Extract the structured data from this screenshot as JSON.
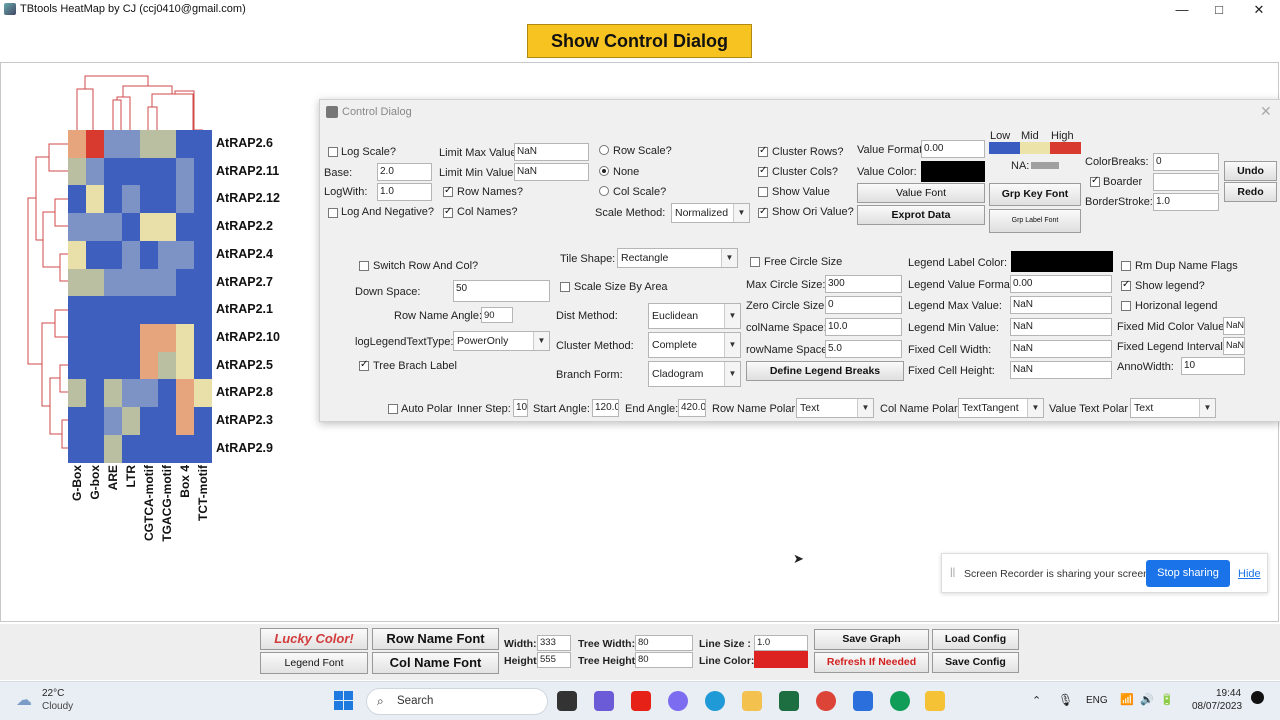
{
  "window": {
    "title": "TBtools HeatMap by CJ (ccj0410@gmail.com)",
    "minimize": "—",
    "maximize": "□",
    "close": "✕"
  },
  "show_control_button": "Show Control Dialog",
  "heatmap": {
    "rows": [
      "AtRAP2.6",
      "AtRAP2.11",
      "AtRAP2.12",
      "AtRAP2.2",
      "AtRAP2.4",
      "AtRAP2.7",
      "AtRAP2.1",
      "AtRAP2.10",
      "AtRAP2.5",
      "AtRAP2.8",
      "AtRAP2.3",
      "AtRAP2.9"
    ],
    "cols": [
      "G-Box",
      "G-box",
      "ARE",
      "LTR",
      "CGTCA-motif",
      "TGACG-motif",
      "Box 4",
      "TCT-motif"
    ],
    "palette": {
      "L": "#3f5fbf",
      "LM": "#7d93c6",
      "M": "#b9bfa0",
      "MH": "#e8e0a8",
      "O": "#e6a57c",
      "H": "#d93a2f"
    },
    "cells": [
      [
        "O",
        "H",
        "LM",
        "LM",
        "M",
        "M",
        "L",
        "L"
      ],
      [
        "M",
        "LM",
        "L",
        "L",
        "L",
        "L",
        "LM",
        "L"
      ],
      [
        "L",
        "MH",
        "L",
        "LM",
        "L",
        "L",
        "LM",
        "L"
      ],
      [
        "LM",
        "LM",
        "LM",
        "L",
        "MH",
        "MH",
        "L",
        "L"
      ],
      [
        "MH",
        "L",
        "L",
        "LM",
        "L",
        "LM",
        "LM",
        "L"
      ],
      [
        "M",
        "M",
        "LM",
        "LM",
        "LM",
        "LM",
        "L",
        "L"
      ],
      [
        "L",
        "L",
        "L",
        "L",
        "L",
        "L",
        "L",
        "L"
      ],
      [
        "L",
        "L",
        "L",
        "L",
        "O",
        "O",
        "MH",
        "L"
      ],
      [
        "L",
        "L",
        "L",
        "L",
        "O",
        "M",
        "MH",
        "L"
      ],
      [
        "M",
        "L",
        "M",
        "LM",
        "LM",
        "L",
        "O",
        "MH"
      ],
      [
        "L",
        "L",
        "LM",
        "M",
        "L",
        "L",
        "O",
        "L"
      ],
      [
        "L",
        "L",
        "M",
        "L",
        "L",
        "L",
        "L",
        "L"
      ],
      [
        "L",
        "L",
        "O",
        "MH",
        "L",
        "L",
        "L",
        "L"
      ]
    ]
  },
  "dialog": {
    "title": "Control Dialog",
    "log_scale": "Log Scale?",
    "base_label": "Base:",
    "base_value": "2.0",
    "logwith_label": "LogWith:",
    "logwith_value": "1.0",
    "log_negative": "Log And Negative?",
    "limit_max_label": "Limit Max Value:",
    "limit_max_value": "NaN",
    "limit_min_label": "Limit Min Value:",
    "limit_min_value": "NaN",
    "row_names": "Row Names?",
    "col_names": "Col Names?",
    "row_scale": "Row Scale?",
    "none": "None",
    "col_scale": "Col Scale?",
    "scale_method_label": "Scale Method:",
    "scale_method_value": "Normalized",
    "cluster_rows": "Cluster Rows?",
    "cluster_cols": "Cluster Cols?",
    "show_value": "Show Value",
    "show_ori_value": "Show Ori Value?",
    "value_format_label": "Value Format:",
    "value_format_value": "0.00",
    "value_color_label": "Value Color:",
    "value_font": "Value Font",
    "export_data": "Exprot Data",
    "low": "Low",
    "mid": "Mid",
    "high": "High",
    "na": "NA:",
    "low_color": "#3a5bbf",
    "mid_color": "#ece3a8",
    "high_color": "#d93a2f",
    "na_color": "#a0a0a0",
    "grp_key_font": "Grp Key Font",
    "grp_label_font": "Grp Label Font",
    "color_breaks_label": "ColorBreaks:",
    "color_breaks_value": "0",
    "boarder": "Boarder",
    "boarder_value": "",
    "border_stroke_label": "BorderStroke:",
    "border_stroke_value": "1.0",
    "undo": "Undo",
    "redo": "Redo",
    "switch_row_col": "Switch Row And Col?",
    "down_space_label": "Down Space:",
    "down_space_value": "50",
    "row_name_angle_label": "Row Name Angle:",
    "row_name_angle_value": "90",
    "log_legend_label": "logLegendTextType:",
    "log_legend_value": "PowerOnly",
    "tree_branch_label": "Tree Brach Label",
    "tile_shape_label": "Tile Shape:",
    "tile_shape_value": "Rectangle",
    "scale_size_by_area": "Scale Size By Area",
    "dist_method_label": "Dist Method:",
    "dist_method_value": "Euclidean",
    "cluster_method_label": "Cluster Method:",
    "cluster_method_value": "Complete",
    "branch_form_label": "Branch Form:",
    "branch_form_value": "Cladogram",
    "free_circle_size": "Free Circle Size",
    "max_circle_label": "Max Circle Size:",
    "max_circle_value": "300",
    "zero_circle_label": "Zero Circle Size:",
    "zero_circle_value": "0",
    "colname_space_label": "colName Space:",
    "colname_space_value": "10.0",
    "rowname_space_label": "rowName Space:",
    "rowname_space_value": "5.0",
    "define_legend_breaks": "Define Legend Breaks",
    "legend_label_color_label": "Legend Label Color:",
    "legend_value_format_label": "Legend Value Format:",
    "legend_value_format_value": "0.00",
    "legend_max_label": "Legend Max Value:",
    "legend_max_value": "NaN",
    "legend_min_label": "Legend Min Value:",
    "legend_min_value": "NaN",
    "fixed_cell_width_label": "Fixed Cell Width:",
    "fixed_cell_width_value": "NaN",
    "fixed_cell_height_label": "Fixed Cell Height:",
    "fixed_cell_height_value": "NaN",
    "rm_dup_name": "Rm Dup Name Flags",
    "show_legend": "Show legend?",
    "horizontal_legend": "Horizonal legend",
    "fixed_mid_color_label": "Fixed Mid Color Value:",
    "fixed_mid_color_value": "NaN",
    "fixed_legend_interval_label": "Fixed Legend Interval:",
    "fixed_legend_interval_value": "NaN",
    "anno_width_label": "AnnoWidth:",
    "anno_width_value": "10",
    "auto_polar": "Auto Polar",
    "inner_step_label": "Inner Step:",
    "inner_step_value": "10",
    "start_angle_label": "Start Angle:",
    "start_angle_value": "120.0",
    "end_angle_label": "End Angle:",
    "end_angle_value": "420.0",
    "row_name_polar_label": "Row Name Polar:",
    "row_name_polar_value": "Text",
    "col_name_polar_label": "Col Name Polar:",
    "col_name_polar_value": "TextTangent",
    "value_text_polar_label": "Value Text Polar",
    "value_text_polar_value": "Text"
  },
  "toolbar": {
    "lucky_color": "Lucky Color!",
    "legend_font": "Legend Font",
    "row_name_font": "Row Name Font",
    "col_name_font": "Col Name Font",
    "width_label": "Width:",
    "width_value": "333",
    "height_label": "Height:",
    "height_value": "555",
    "tree_width_label": "Tree Width:",
    "tree_width_value": "80",
    "tree_height_label": "Tree Height:",
    "tree_height_value": "80",
    "line_size_label": "Line Size :",
    "line_size_value": "1.0",
    "line_color_label": "Line Color:",
    "line_color": "#dd2222",
    "save_graph": "Save Graph",
    "refresh": "Refresh If Needed",
    "load_config": "Load Config",
    "save_config": "Save Config"
  },
  "share_bar": {
    "message": "Screen Recorder is sharing your screen.",
    "stop": "Stop sharing",
    "hide": "Hide"
  },
  "taskbar": {
    "weather_temp": "22°C",
    "weather_desc": "Cloudy",
    "search_placeholder": "Search",
    "lang": "ENG",
    "time": "19:44",
    "date": "08/07/2023"
  }
}
